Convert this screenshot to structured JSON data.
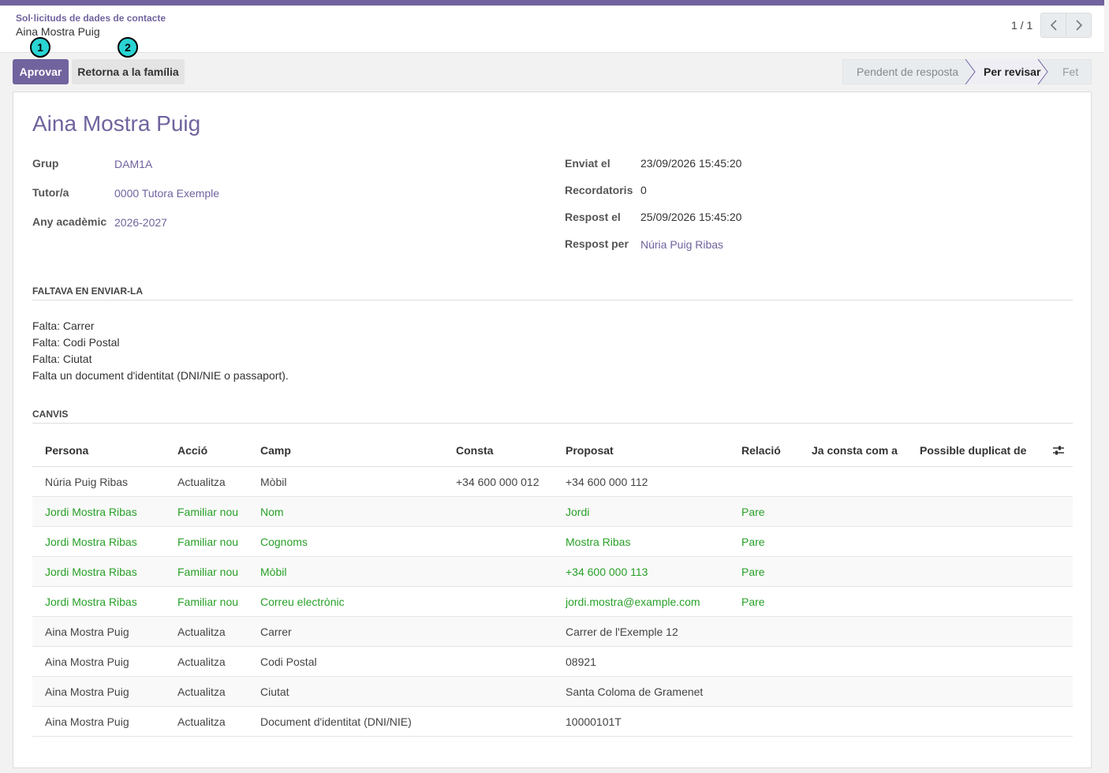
{
  "breadcrumb": {
    "parent": "Sol·licituds de dades de contacte",
    "current": "Aina Mostra Puig"
  },
  "pager": {
    "value": "1 / 1"
  },
  "actions": {
    "approve_label": "Aprovar",
    "return_label": "Retorna a la família"
  },
  "markers": {
    "first": "1",
    "second": "2"
  },
  "status": {
    "stages": [
      "Pendent de resposta",
      "Per revisar",
      "Fet"
    ],
    "active": "Per revisar"
  },
  "record": {
    "title": "Aina Mostra Puig",
    "left_fields": [
      {
        "label": "Grup",
        "value": "DAM1A"
      },
      {
        "label": "Tutor/a",
        "value": "0000 Tutora Exemple"
      },
      {
        "label": "Any acadèmic",
        "value": "2026-2027"
      }
    ],
    "right_fields": [
      {
        "label": "Enviat el",
        "value": "23/09/2026 15:45:20"
      },
      {
        "label": "Recordatoris",
        "value": "0"
      },
      {
        "label": "Respost el",
        "value": "25/09/2026 15:45:20"
      },
      {
        "label": "Respost per",
        "value": "Núria Puig Ribas"
      }
    ]
  },
  "missing_section": {
    "title": "FALTAVA EN ENVIAR-LA",
    "lines": [
      "Falta: Carrer",
      "Falta: Codi Postal",
      "Falta: Ciutat",
      "Falta un document d'identitat (DNI/NIE o passaport)."
    ]
  },
  "changes_section": {
    "title": "CANVIS",
    "columns": [
      "Persona",
      "Acció",
      "Camp",
      "Consta",
      "Proposat",
      "Relació",
      "Ja consta com a",
      "Possible duplicat de"
    ],
    "rows": [
      {
        "persona": "Núria Puig Ribas",
        "accio": "Actualitza",
        "camp": "Mòbil",
        "consta": "+34 600 000 012",
        "proposat": "+34 600 000 112",
        "relacio": ""
      },
      {
        "persona": "Jordi Mostra Ribas",
        "accio": "Familiar nou",
        "camp": "Nom",
        "consta": "",
        "proposat": "Jordi",
        "relacio": "Pare"
      },
      {
        "persona": "Jordi Mostra Ribas",
        "accio": "Familiar nou",
        "camp": "Cognoms",
        "consta": "",
        "proposat": "Mostra Ribas",
        "relacio": "Pare"
      },
      {
        "persona": "Jordi Mostra Ribas",
        "accio": "Familiar nou",
        "camp": "Mòbil",
        "consta": "",
        "proposat": "+34 600 000 113",
        "relacio": "Pare"
      },
      {
        "persona": "Jordi Mostra Ribas",
        "accio": "Familiar nou",
        "camp": "Correu electrònic",
        "consta": "",
        "proposat": "jordi.mostra@example.com",
        "relacio": "Pare"
      },
      {
        "persona": "Aina Mostra Puig",
        "accio": "Actualitza",
        "camp": "Carrer",
        "consta": "",
        "proposat": "Carrer de l'Exemple 12",
        "relacio": ""
      },
      {
        "persona": "Aina Mostra Puig",
        "accio": "Actualitza",
        "camp": "Codi Postal",
        "consta": "",
        "proposat": "08921",
        "relacio": ""
      },
      {
        "persona": "Aina Mostra Puig",
        "accio": "Actualitza",
        "camp": "Ciutat",
        "consta": "",
        "proposat": "Santa Coloma de Gramenet",
        "relacio": ""
      },
      {
        "persona": "Aina Mostra Puig",
        "accio": "Actualitza",
        "camp": "Document d'identitat (DNI/NIE)",
        "consta": "",
        "proposat": "10000101T",
        "relacio": ""
      }
    ]
  },
  "colors": {
    "brand": "#71639e",
    "new_row": "#28a028",
    "marker": "#2ad4d4"
  }
}
